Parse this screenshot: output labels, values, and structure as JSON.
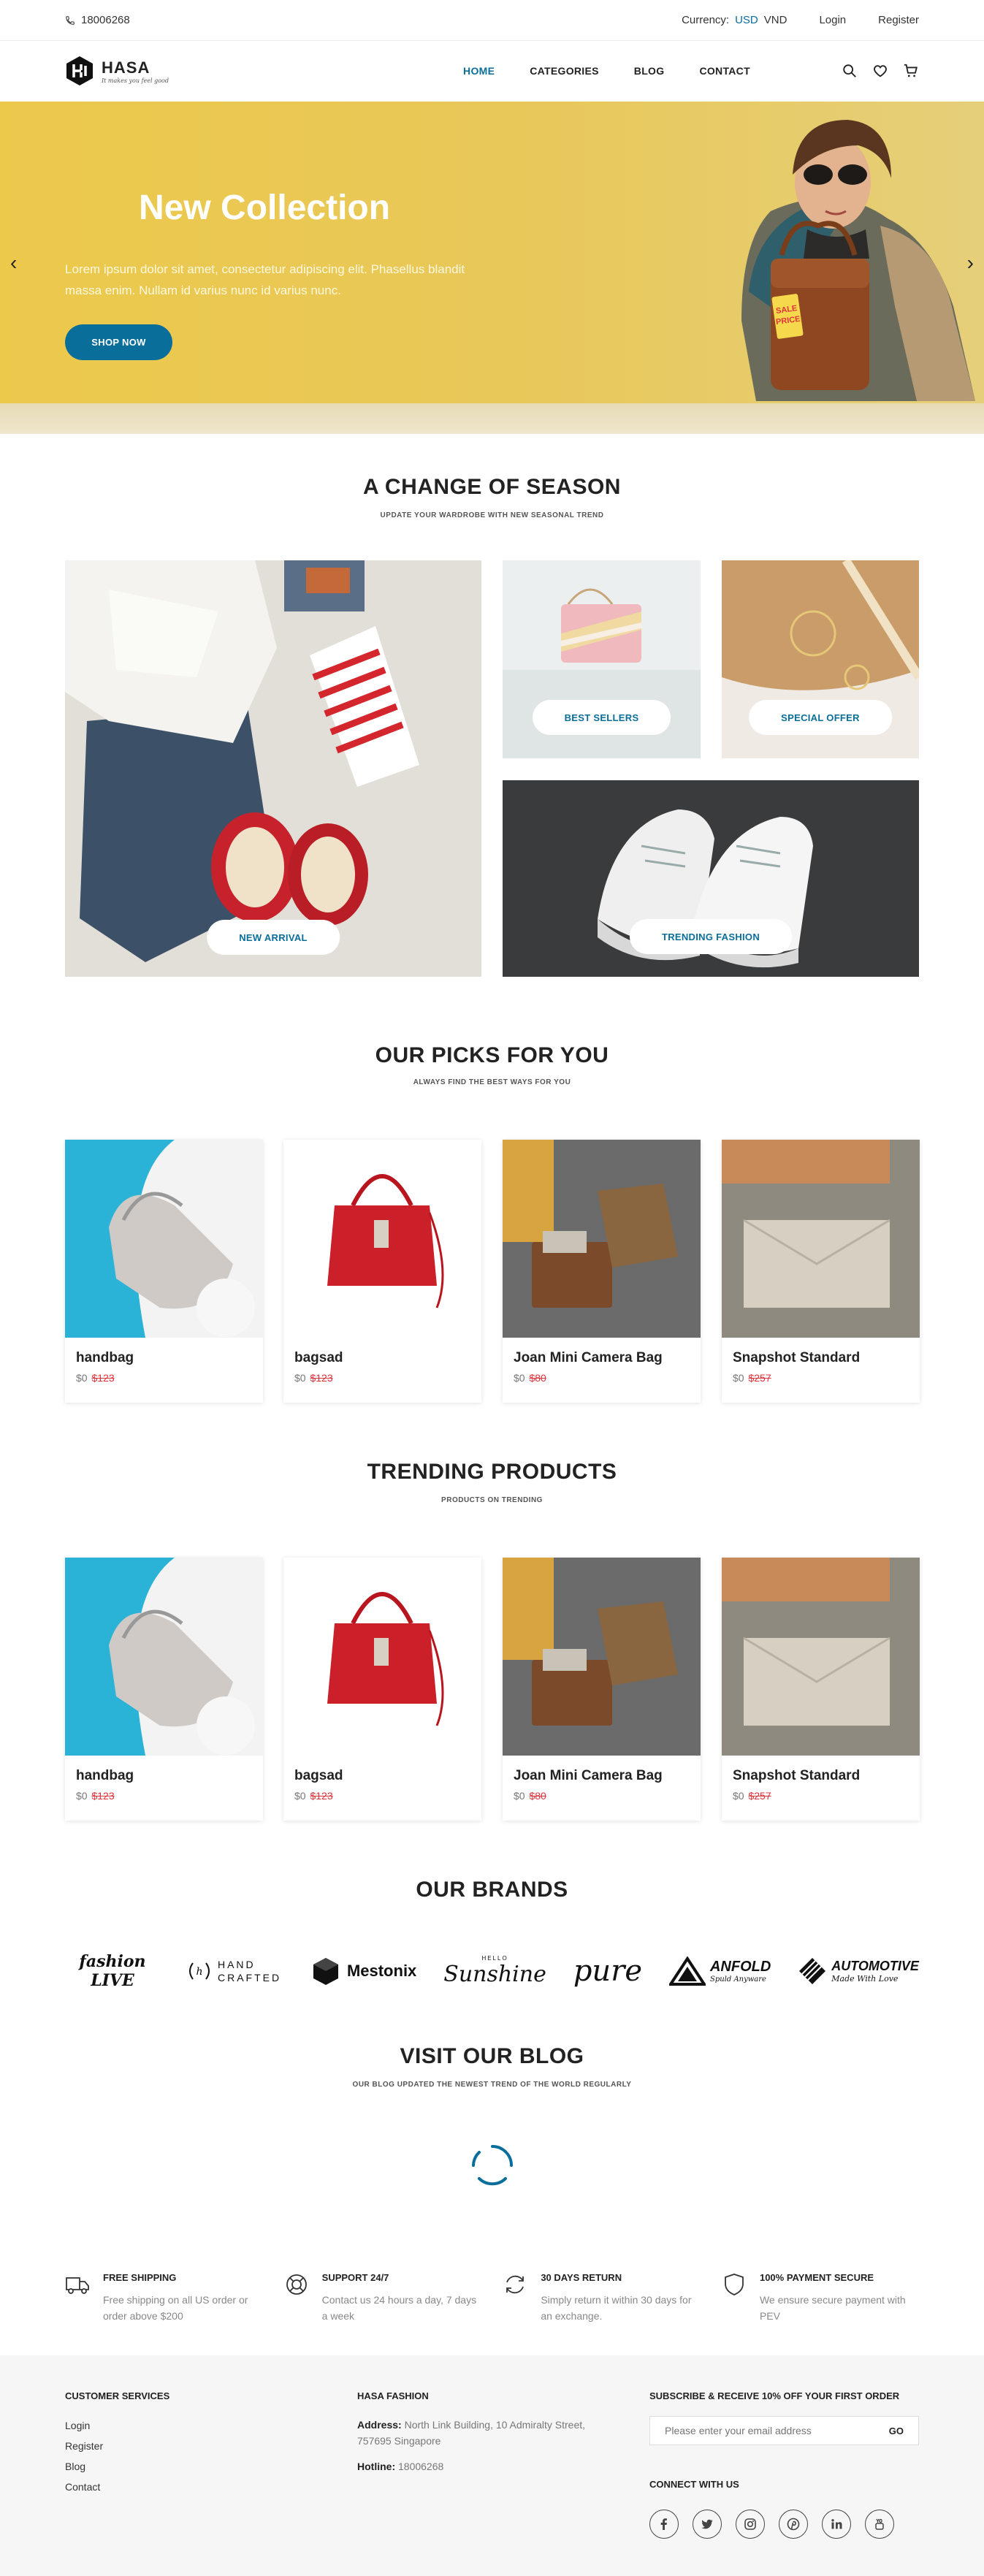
{
  "topbar": {
    "phone": "18006268",
    "currency_label": "Currency:",
    "currencies": [
      "USD",
      "VND"
    ],
    "login": "Login",
    "register": "Register"
  },
  "header": {
    "logo_name": "HASA",
    "logo_tagline": "It makes you feel good",
    "nav": [
      "HOME",
      "CATEGORIES",
      "BLOG",
      "CONTACT"
    ],
    "active_nav": "HOME"
  },
  "hero": {
    "title": "New Collection",
    "description": "Lorem ipsum dolor sit amet, consectetur adipiscing elit. Phasellus blandit massa enim. Nullam id varius nunc id varius nunc.",
    "button": "SHOP NOW",
    "tag_text": "SALE PRICE"
  },
  "season": {
    "title": "A CHANGE OF SEASON",
    "subtitle": "UPDATE YOUR WARDROBE WITH NEW SEASONAL TREND",
    "tiles": [
      "NEW ARRIVAL",
      "BEST SELLERS",
      "SPECIAL OFFER",
      "TRENDING FASHION"
    ]
  },
  "picks": {
    "title": "OUR PICKS FOR YOU",
    "subtitle": "ALWAYS FIND THE BEST WAYS FOR YOU",
    "products": [
      {
        "name": "handbag",
        "price": "$0",
        "old_price": "$123"
      },
      {
        "name": "bagsad",
        "price": "$0",
        "old_price": "$123"
      },
      {
        "name": "Joan Mini Camera Bag",
        "price": "$0",
        "old_price": "$80"
      },
      {
        "name": "Snapshot Standard",
        "price": "$0",
        "old_price": "$257"
      }
    ]
  },
  "trending": {
    "title": "TRENDING PRODUCTS",
    "subtitle": "PRODUCTS ON TRENDING",
    "products": [
      {
        "name": "handbag",
        "price": "$0",
        "old_price": "$123"
      },
      {
        "name": "bagsad",
        "price": "$0",
        "old_price": "$123"
      },
      {
        "name": "Joan Mini Camera Bag",
        "price": "$0",
        "old_price": "$80"
      },
      {
        "name": "Snapshot Standard",
        "price": "$0",
        "old_price": "$257"
      }
    ]
  },
  "brands": {
    "title": "OUR BRANDS",
    "items": [
      "fashion LIVE",
      "HAND CRAFTED",
      "Mestonix",
      "Sunshine",
      "pure",
      "ANFOLD",
      "AUTOMOTIVE"
    ],
    "subtexts": {
      "anfold": "Spuld Anyware",
      "automotive": "Made With Love",
      "sunshine": "HELLO"
    }
  },
  "blog": {
    "title": "VISIT OUR BLOG",
    "subtitle": "OUR BLOG UPDATED THE NEWEST TREND OF THE WORLD REGULARLY"
  },
  "features": [
    {
      "title": "FREE SHIPPING",
      "desc": "Free shipping on all US order or order above $200",
      "icon": "truck-icon"
    },
    {
      "title": "SUPPORT 24/7",
      "desc": "Contact us 24 hours a day, 7 days a week",
      "icon": "lifebuoy-icon"
    },
    {
      "title": "30 DAYS RETURN",
      "desc": "Simply return it within 30 days for an exchange.",
      "icon": "return-icon"
    },
    {
      "title": "100% PAYMENT SECURE",
      "desc": "We ensure secure payment with PEV",
      "icon": "shield-icon"
    }
  ],
  "footer": {
    "services_title": "CUSTOMER SERVICES",
    "services_links": [
      "Login",
      "Register",
      "Blog",
      "Contact"
    ],
    "company_title": "HASA FASHION",
    "address_label": "Address:",
    "address": "North Link Building, 10 Admiralty Street, 757695 Singapore",
    "hotline_label": "Hotline:",
    "hotline": "18006268",
    "subscribe_title": "SUBSCRIBE & RECEIVE 10% OFF YOUR FIRST ORDER",
    "email_placeholder": "Please enter your email address",
    "go": "GO",
    "connect_title": "CONNECT WITH US",
    "socials": [
      "facebook-icon",
      "twitter-icon",
      "instagram-icon",
      "pinterest-icon",
      "linkedin-icon",
      "youtube-icon"
    ]
  },
  "colors": {
    "accent": "#0a6e9b",
    "hero_bg": "#ecc94b",
    "sale": "#e0323a"
  }
}
